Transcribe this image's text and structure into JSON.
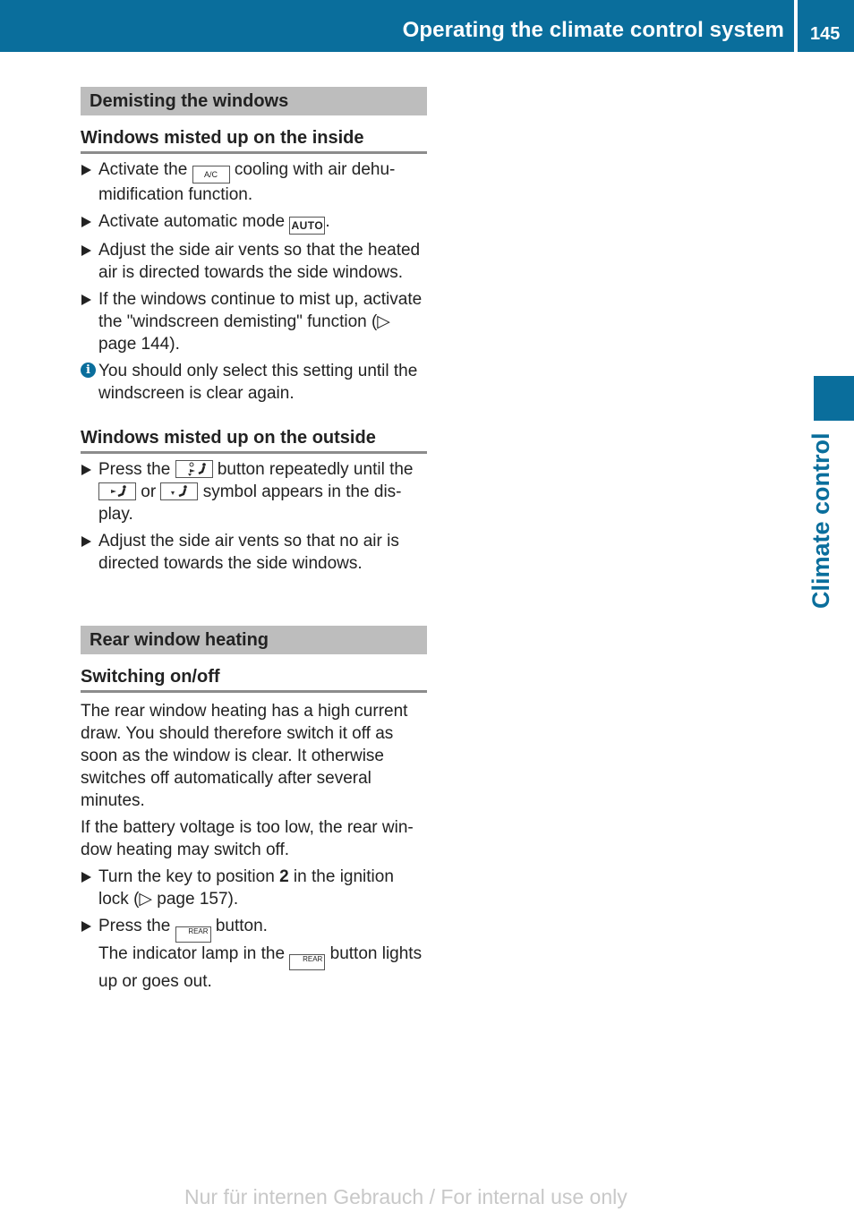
{
  "header": {
    "title": "Operating the climate control system",
    "page_number": "145"
  },
  "side_tab": {
    "label": "Climate control"
  },
  "sections": {
    "demisting": {
      "title": "Demisting the windows",
      "inside": {
        "title": "Windows misted up on the inside",
        "step1_a": "Activate the ",
        "step1_btn": "A/C",
        "step1_b": " cooling with air dehu-midification function.",
        "step2_a": "Activate automatic mode ",
        "step2_btn": "AUTO",
        "step2_b": ".",
        "step3": "Adjust the side air vents so that the heated air is directed towards the side windows.",
        "step4": "If the windows continue to mist up, activate the \"windscreen demisting\" function (▷ page 144).",
        "info_icon": "i",
        "info": "You should only select this setting until the windscreen is clear again."
      },
      "outside": {
        "title": "Windows misted up on the outside",
        "step1_a": "Press the ",
        "step1_b": " button repeatedly until the ",
        "step1_c": " or ",
        "step1_d": " symbol appears in the dis-play.",
        "step2": "Adjust the side air vents so that no air is directed towards the side windows."
      }
    },
    "rear_heating": {
      "title": "Rear window heating",
      "switching": {
        "title": "Switching on/off",
        "para1": "The rear window heating has a high current draw. You should therefore switch it off as soon as the window is clear. It otherwise switches off automatically after several minutes.",
        "para2": "If the battery voltage is too low, the rear win-dow heating may switch off.",
        "step1_a": "Turn the key to position ",
        "step1_bold": "2",
        "step1_b": " in the ignition lock (▷ page 157).",
        "step2_a": "Press the ",
        "step2_b": " button.",
        "step2_c": "The indicator lamp in the ",
        "step2_d": " button lights up or goes out.",
        "rear_btn_label": "REAR"
      }
    }
  },
  "footer": {
    "note": "Nur für internen Gebrauch / For internal use only"
  }
}
